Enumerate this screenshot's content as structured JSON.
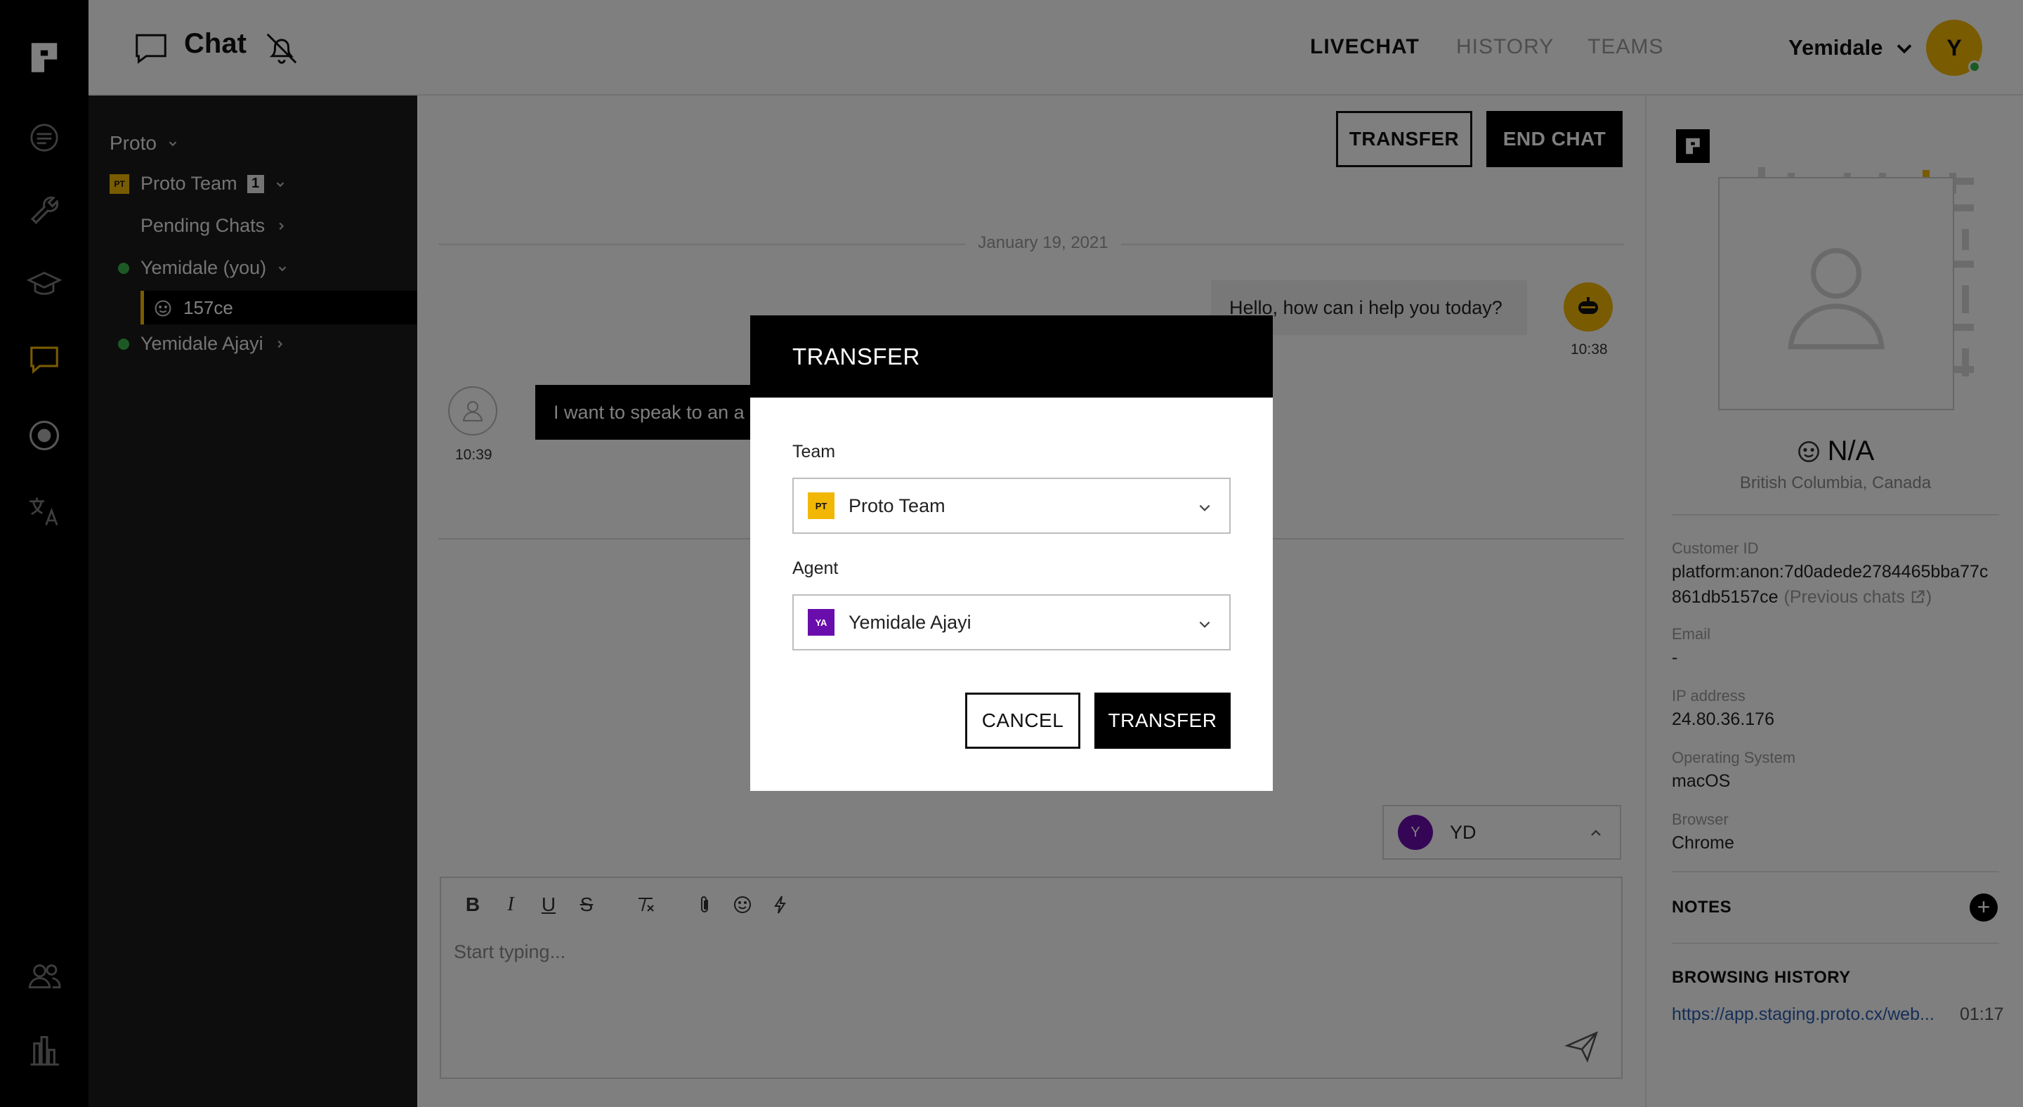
{
  "header": {
    "title": "Chat",
    "tabs": [
      "LIVECHAT",
      "HISTORY",
      "TEAMS"
    ],
    "user_name": "Yemidale",
    "user_initial": "Y"
  },
  "sidebar": {
    "org": "Proto",
    "team": {
      "badge": "PT",
      "name": "Proto Team",
      "count": "1"
    },
    "pending": "Pending Chats",
    "agent_self": "Yemidale (you)",
    "active_chat": "157ce",
    "agent_other": "Yemidale Ajayi"
  },
  "chat": {
    "transfer_label": "TRANSFER",
    "end_chat_label": "END CHAT",
    "date": "January 19, 2021",
    "bot_message": "Hello, how can i help you today?",
    "bot_time": "10:38",
    "customer_message": "I want to speak to an a",
    "customer_time": "10:39",
    "agent_select": {
      "initial": "Y",
      "label": "YD"
    },
    "composer_placeholder": "Start typing...",
    "toolbar": {
      "bold": "B",
      "italic": "I",
      "underline": "U",
      "strike": "S"
    }
  },
  "customer": {
    "name": "N/A",
    "location": "British Columbia, Canada",
    "fields": [
      {
        "label": "Customer ID",
        "value": "platform:anon:7d0adede2784465bba77c",
        "value2": "861db5157ce",
        "link": "(Previous chats"
      },
      {
        "label": "Email",
        "value": "-"
      },
      {
        "label": "IP address",
        "value": "24.80.36.176"
      },
      {
        "label": "Operating System",
        "value": "macOS"
      },
      {
        "label": "Browser",
        "value": "Chrome"
      }
    ],
    "notes_title": "NOTES",
    "history_title": "BROWSING HISTORY",
    "history_link": "https://app.staging.proto.cx/web...",
    "history_time": "01:17"
  },
  "modal": {
    "title": "TRANSFER",
    "team_label": "Team",
    "team_badge": "PT",
    "team_value": "Proto Team",
    "agent_label": "Agent",
    "agent_badge": "YA",
    "agent_value": "Yemidale Ajayi",
    "cancel_label": "CANCEL",
    "confirm_label": "TRANSFER"
  },
  "colors": {
    "brand_yellow": "#f2b705",
    "online_green": "#39b54a",
    "agent_purple": "#6a0dad",
    "link_blue": "#2a5db0"
  }
}
